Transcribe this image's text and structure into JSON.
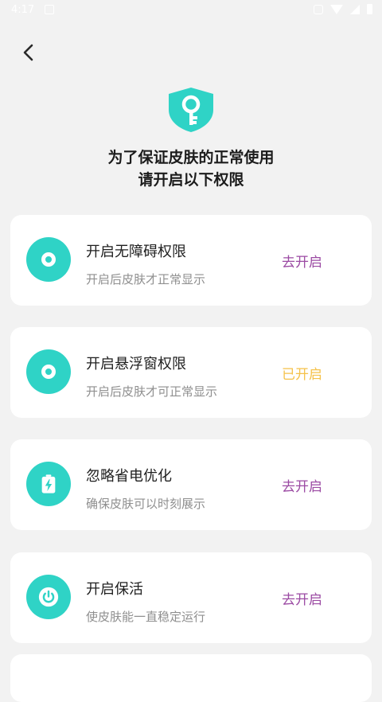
{
  "status_bar": {
    "time": "4:17"
  },
  "header": {
    "title_line1": "为了保证皮肤的正常使用",
    "title_line2": "请开启以下权限"
  },
  "colors": {
    "accent": "#2fd3c6",
    "action_pending": "#9b4aa3",
    "action_done": "#f5c24a"
  },
  "permissions": [
    {
      "icon": "accessibility-icon",
      "title": "开启无障碍权限",
      "subtitle": "开启后皮肤才正常显示",
      "action": "去开启",
      "enabled": false
    },
    {
      "icon": "floating-window-icon",
      "title": "开启悬浮窗权限",
      "subtitle": "开启后皮肤才可正常显示",
      "action": "已开启",
      "enabled": true
    },
    {
      "icon": "battery-icon",
      "title": "忽略省电优化",
      "subtitle": "确保皮肤可以时刻展示",
      "action": "去开启",
      "enabled": false
    },
    {
      "icon": "power-icon",
      "title": "开启保活",
      "subtitle": "使皮肤能一直稳定运行",
      "action": "去开启",
      "enabled": false
    }
  ]
}
